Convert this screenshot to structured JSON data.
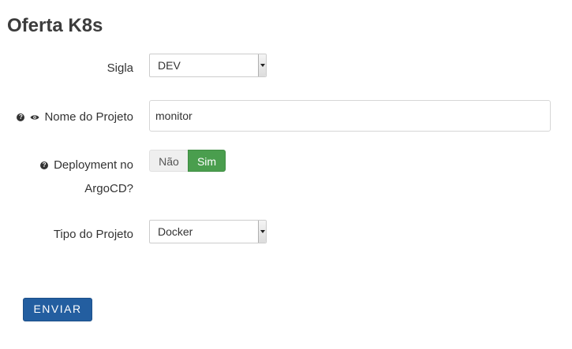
{
  "page": {
    "title": "Oferta K8s"
  },
  "form": {
    "sigla": {
      "label": "Sigla",
      "value": "DEV"
    },
    "nome_projeto": {
      "label": "Nome do Projeto",
      "value": "monitor",
      "icons": [
        "question-circle-icon",
        "eye-icon"
      ]
    },
    "deployment_argocd": {
      "label_line1": "Deployment no",
      "label_line2": "ArgoCD?",
      "icon": "question-circle-icon",
      "options": [
        "Não",
        "Sim"
      ],
      "selected": "Sim",
      "selected_color": "#4a9e4e"
    },
    "tipo_projeto": {
      "label": "Tipo do Projeto",
      "value": "Docker"
    },
    "submit_label": "ENVIAR",
    "submit_color": "#235ea0"
  }
}
